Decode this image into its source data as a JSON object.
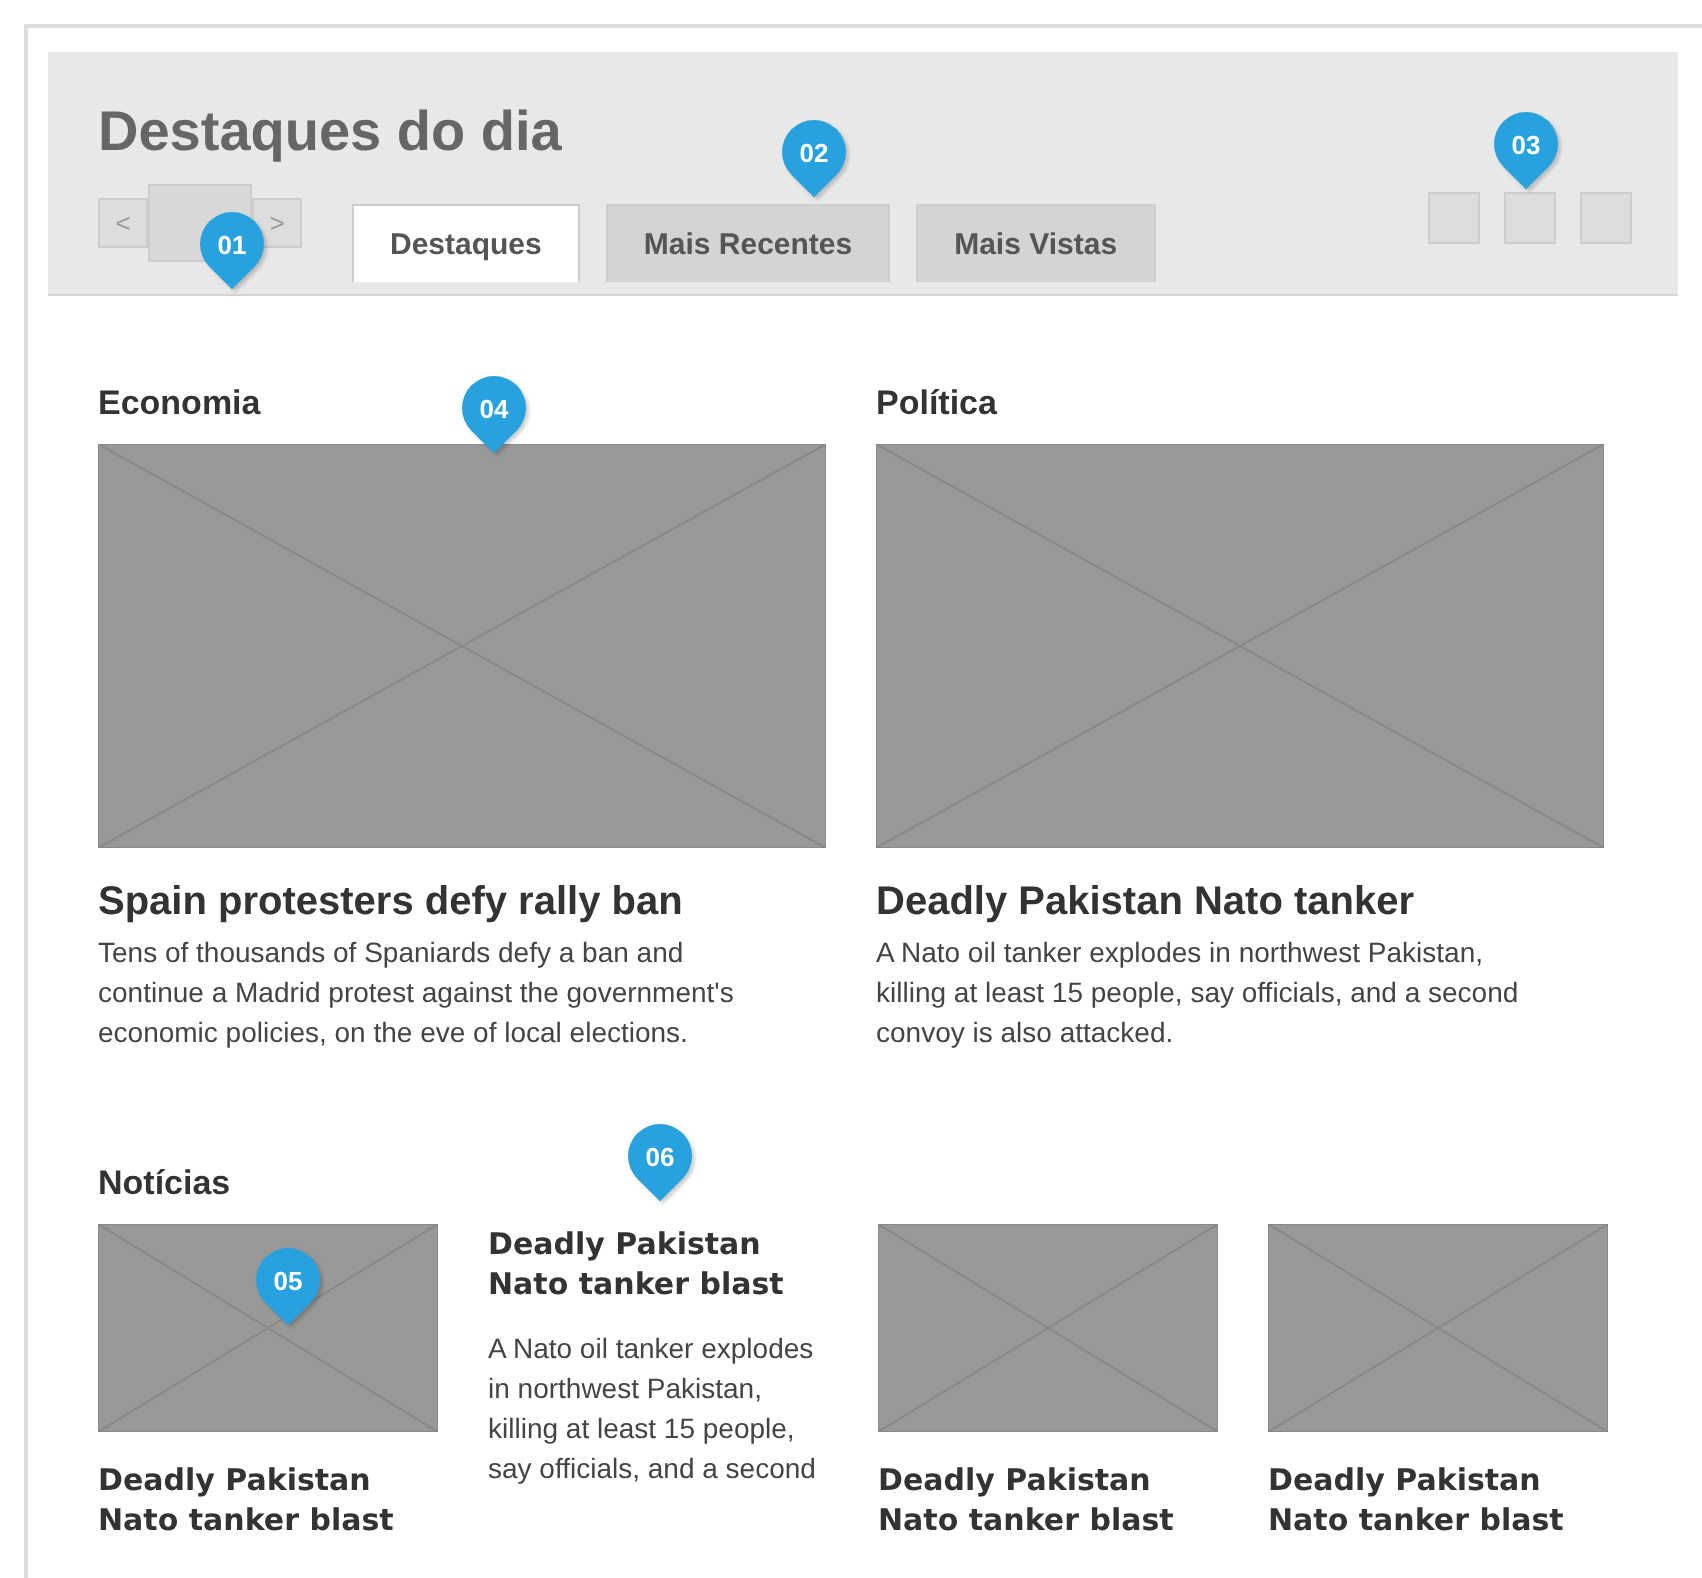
{
  "header": {
    "title": "Destaques do dia",
    "carousel": {
      "prev": "<",
      "next": ">"
    },
    "tabs": [
      {
        "label": "Destaques",
        "selected": true
      },
      {
        "label": "Mais Recentes",
        "selected": false
      },
      {
        "label": "Mais Vistas",
        "selected": false
      }
    ]
  },
  "featured": [
    {
      "section": "Economia",
      "headline": "Spain protesters defy rally ban",
      "summary": "Tens of thousands of Spaniards defy a ban and continue a Madrid protest against the government's economic policies, on the eve of local elections."
    },
    {
      "section": "Política",
      "headline": "Deadly Pakistan Nato tanker",
      "summary": "A Nato oil tanker explodes in northwest Pakistan, killing at least 15 people, say officials, and a second convoy is also attacked."
    }
  ],
  "news": {
    "section": "Notícias",
    "items": [
      {
        "kind": "image",
        "headline": "Deadly Pakistan Nato tanker blast"
      },
      {
        "kind": "text",
        "headline": "Deadly Pakistan Nato tanker blast",
        "summary": "A Nato oil tanker explodes in northwest Pakistan, killing at least 15 people, say officials, and a second"
      },
      {
        "kind": "image",
        "headline": "Deadly Pakistan Nato tanker blast"
      },
      {
        "kind": "image",
        "headline": "Deadly Pakistan Nato tanker blast"
      }
    ]
  },
  "annotations": [
    {
      "label": "01"
    },
    {
      "label": "02"
    },
    {
      "label": "03"
    },
    {
      "label": "04"
    },
    {
      "label": "05"
    },
    {
      "label": "06"
    }
  ]
}
